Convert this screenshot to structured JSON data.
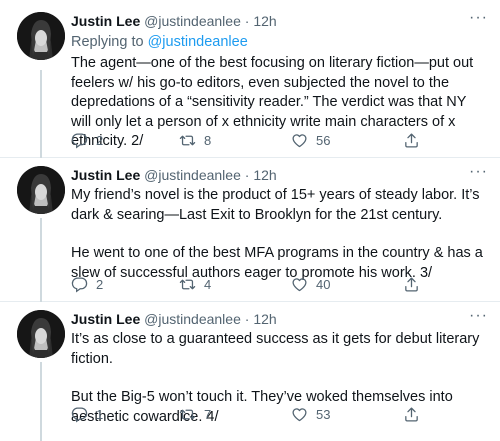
{
  "tweets": [
    {
      "name": "Justin Lee",
      "handle": "@justindeanlee",
      "time": "12h",
      "replying_to_prefix": "Replying to ",
      "replying_to_handle": "@justindeanlee",
      "text": [
        "The agent—one of the best focusing on literary fiction—put out feelers w/ his go-to editors, even subjected the novel to the depredations of a “sensitivity reader.” The verdict was that NY will only let a person of x ethnicity write main characters of x ethnicity. 2/"
      ],
      "replies": "2",
      "retweets": "8",
      "likes": "56"
    },
    {
      "name": "Justin Lee",
      "handle": "@justindeanlee",
      "time": "12h",
      "text": [
        "My friend’s novel is the product of 15+ years of steady labor. It’s dark & searing—Last Exit to Brooklyn for the 21st century.",
        "He went to one of the best MFA programs in the country & has a slew of successful authors eager to promote his work. 3/"
      ],
      "replies": "2",
      "retweets": "4",
      "likes": "40"
    },
    {
      "name": "Justin Lee",
      "handle": "@justindeanlee",
      "time": "12h",
      "text": [
        "It’s as close to a guaranteed success as it gets for debut literary fiction.",
        "But the Big-5 won’t touch it. They’ve woked themselves into aesthetic cowardice. 4/"
      ],
      "replies": "1",
      "retweets": "7",
      "likes": "53"
    }
  ],
  "separator": " · ",
  "more_glyph": "···",
  "icons": {
    "reply": "reply-icon",
    "retweet": "retweet-icon",
    "like": "like-icon",
    "share": "share-icon"
  },
  "colors": {
    "link": "#1d9bf0",
    "muted": "#536471",
    "text": "#0f1419",
    "divider": "#e6ecf0"
  }
}
